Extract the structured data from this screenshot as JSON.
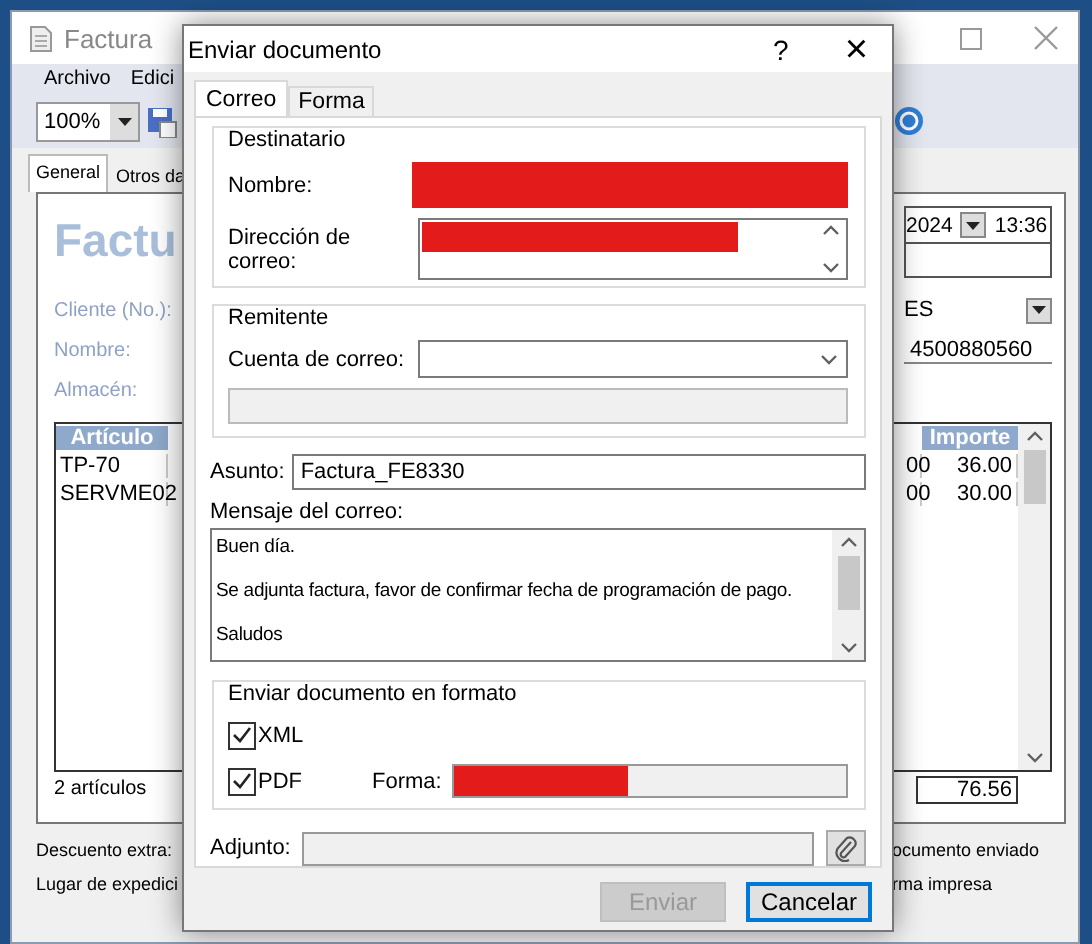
{
  "background_window": {
    "title": "Factura",
    "menu": [
      "Archivo",
      "Edici"
    ],
    "zoom": "100%",
    "tabs": [
      {
        "label": "General",
        "selected": true
      },
      {
        "label": "Otros da",
        "selected": false
      }
    ],
    "heading": "Factu",
    "date": "2024",
    "time": "13:36",
    "form_rows": [
      {
        "label": "Cliente (No.):",
        "value": "ES",
        "kind": "combo"
      },
      {
        "label": "Nombre:",
        "value": "4500880560",
        "kind": "text"
      },
      {
        "label": "Almacén:",
        "kind": "blank"
      }
    ],
    "table": {
      "columns": [
        "Artículo",
        "Importe"
      ],
      "rows": [
        {
          "column_1": "TP-70",
          "column_2": "00",
          "column_3": "36.00"
        },
        {
          "column_1": "SERVME02",
          "column_2": "00",
          "column_3": "30.00"
        }
      ]
    },
    "item_count": "2 artículos",
    "total": "76.56",
    "bottom_left": [
      "Descuento extra:",
      "Lugar de expedici"
    ],
    "bottom_right": [
      "ocumento enviado",
      "rma impresa"
    ]
  },
  "dialog": {
    "title": "Enviar documento",
    "help": "?",
    "close": "×",
    "tabs": [
      {
        "label": "Correo",
        "selected": true
      },
      {
        "label": "Forma",
        "selected": false
      }
    ],
    "recipient": {
      "legend": "Destinatario",
      "name_label": "Nombre:",
      "email_label": "Dirección de correo:"
    },
    "sender": {
      "legend": "Remitente",
      "account_label": "Cuenta de correo:"
    },
    "subject_label": "Asunto:",
    "subject": "Factura_FE8330",
    "message_label": "Mensaje del correo:",
    "message": [
      "Buen día.",
      "Se adjunta factura, favor de confirmar fecha de programación de pago.",
      "Saludos"
    ],
    "format": {
      "legend": "Enviar documento en formato",
      "options": [
        {
          "label": "XML",
          "checked": true
        },
        {
          "label": "PDF",
          "checked": true
        }
      ],
      "form_label": "Forma:"
    },
    "attachment_label": "Adjunto:",
    "buttons": [
      {
        "label": "Enviar",
        "disabled": true,
        "default": false
      },
      {
        "label": "Cancelar",
        "disabled": false,
        "default": true
      }
    ]
  }
}
